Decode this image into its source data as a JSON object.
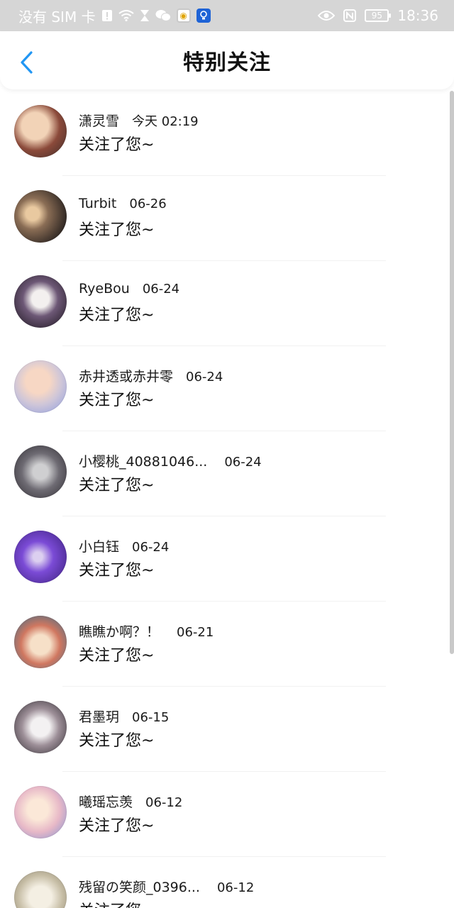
{
  "status_bar": {
    "carrier": "没有 SIM 卡",
    "battery": "95",
    "time": "18:36"
  },
  "header": {
    "title": "特别关注"
  },
  "list": [
    {
      "name": "潇灵雪",
      "date": "今天 02:19",
      "action": "关注了您~"
    },
    {
      "name": "Turbit",
      "date": "06-26",
      "action": "关注了您~"
    },
    {
      "name": "RyeBou",
      "date": "06-24",
      "action": "关注了您~"
    },
    {
      "name": "赤井透或赤井零",
      "date": "06-24",
      "action": "关注了您~"
    },
    {
      "name": "小樱桃_40881046...",
      "date": "06-24",
      "action": "关注了您~"
    },
    {
      "name": "小白钰",
      "date": "06-24",
      "action": "关注了您~"
    },
    {
      "name": "瞧瞧か啊？！",
      "date": "06-21",
      "action": "关注了您~"
    },
    {
      "name": "君墨玥",
      "date": "06-15",
      "action": "关注了您~"
    },
    {
      "name": "曦瑶忘羡",
      "date": "06-12",
      "action": "关注了您~"
    },
    {
      "name": "残留の笑颜_0396...",
      "date": "06-12",
      "action": "关注了您~"
    }
  ],
  "colors": {
    "status_bar_bg": "#d6d6d6",
    "accent_back": "#2196f3",
    "text": "#111111"
  },
  "icons": {
    "back": "chevron-left-icon"
  }
}
